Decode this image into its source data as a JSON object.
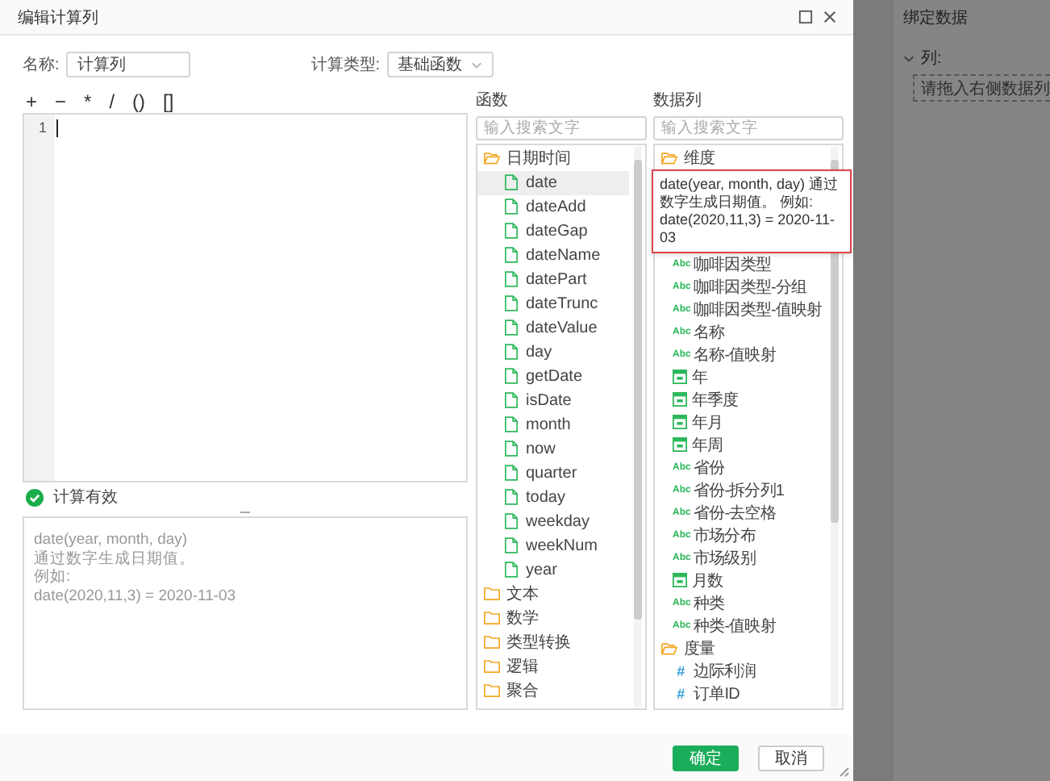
{
  "dialog": {
    "title": "编辑计算列"
  },
  "name_field": {
    "label": "名称:",
    "value": "计算列"
  },
  "calc_type": {
    "label": "计算类型:",
    "value": "基础函数"
  },
  "operators": [
    "+",
    "−",
    "*",
    "/",
    "()",
    "[]"
  ],
  "editor": {
    "line_numbers": [
      "1"
    ]
  },
  "status": {
    "valid": true,
    "text": "计算有效"
  },
  "description": [
    "date(year, month, day)",
    "通过数字生成日期值。",
    "例如:",
    "date(2020,11,3) = 2020-11-03"
  ],
  "functions": {
    "label": "函数",
    "search_placeholder": "输入搜索文字",
    "tree": [
      {
        "name": "日期时间",
        "expanded": true,
        "children": [
          {
            "name": "date",
            "selected": true
          },
          {
            "name": "dateAdd",
            "selected": false
          },
          {
            "name": "dateGap",
            "selected": false
          },
          {
            "name": "dateName",
            "selected": false
          },
          {
            "name": "datePart",
            "selected": false
          },
          {
            "name": "dateTrunc",
            "selected": false
          },
          {
            "name": "dateValue",
            "selected": false
          },
          {
            "name": "day",
            "selected": false
          },
          {
            "name": "getDate",
            "selected": false
          },
          {
            "name": "isDate",
            "selected": false
          },
          {
            "name": "month",
            "selected": false
          },
          {
            "name": "now",
            "selected": false
          },
          {
            "name": "quarter",
            "selected": false
          },
          {
            "name": "today",
            "selected": false
          },
          {
            "name": "weekday",
            "selected": false
          },
          {
            "name": "weekNum",
            "selected": false
          },
          {
            "name": "year",
            "selected": false
          }
        ]
      },
      {
        "name": "文本",
        "expanded": false
      },
      {
        "name": "数学",
        "expanded": false
      },
      {
        "name": "类型转换",
        "expanded": false
      },
      {
        "name": "逻辑",
        "expanded": false
      },
      {
        "name": "聚合",
        "expanded": false
      }
    ]
  },
  "data_columns": {
    "label": "数据列",
    "search_placeholder": "输入搜索文字",
    "tooltip": "date(year, month, day) 通过数字生成日期值。 例如: date(2020,11,3) = 2020-11-03",
    "groups": [
      {
        "name": "维度",
        "expanded": true,
        "children": [
          {
            "kind": "text",
            "badge": "Abc",
            "name": "咖啡因类型"
          },
          {
            "kind": "text",
            "badge": "Abc",
            "name": "咖啡因类型-分组"
          },
          {
            "kind": "text",
            "badge": "Abc",
            "name": "咖啡因类型-值映射"
          },
          {
            "kind": "text",
            "badge": "Abc",
            "name": "名称"
          },
          {
            "kind": "text",
            "badge": "Abc",
            "name": "名称-值映射"
          },
          {
            "kind": "date",
            "name": "年"
          },
          {
            "kind": "date",
            "name": "年季度"
          },
          {
            "kind": "date",
            "name": "年月"
          },
          {
            "kind": "date",
            "name": "年周"
          },
          {
            "kind": "text",
            "badge": "Abc",
            "name": "省份"
          },
          {
            "kind": "text",
            "badge": "Abc",
            "name": "省份-拆分列1"
          },
          {
            "kind": "text",
            "badge": "Abc",
            "name": "省份-去空格"
          },
          {
            "kind": "text",
            "badge": "Abc",
            "name": "市场分布"
          },
          {
            "kind": "text",
            "badge": "Abc",
            "name": "市场级别"
          },
          {
            "kind": "date",
            "name": "月数"
          },
          {
            "kind": "text",
            "badge": "Abc",
            "name": "种类"
          },
          {
            "kind": "text",
            "badge": "Abc",
            "name": "种类-值映射"
          }
        ]
      },
      {
        "name": "度量",
        "expanded": true,
        "children": [
          {
            "kind": "number",
            "badge": "#",
            "name": "边际利润"
          },
          {
            "kind": "number",
            "badge": "#",
            "name": "订单ID"
          }
        ]
      }
    ]
  },
  "buttons": [
    {
      "kind": "primary",
      "label": "确定"
    },
    {
      "kind": "default",
      "label": "取消"
    }
  ],
  "background_panel": {
    "title": "绑定数据",
    "section": "列:",
    "drop_placeholder": "请拖入右侧数据列"
  }
}
